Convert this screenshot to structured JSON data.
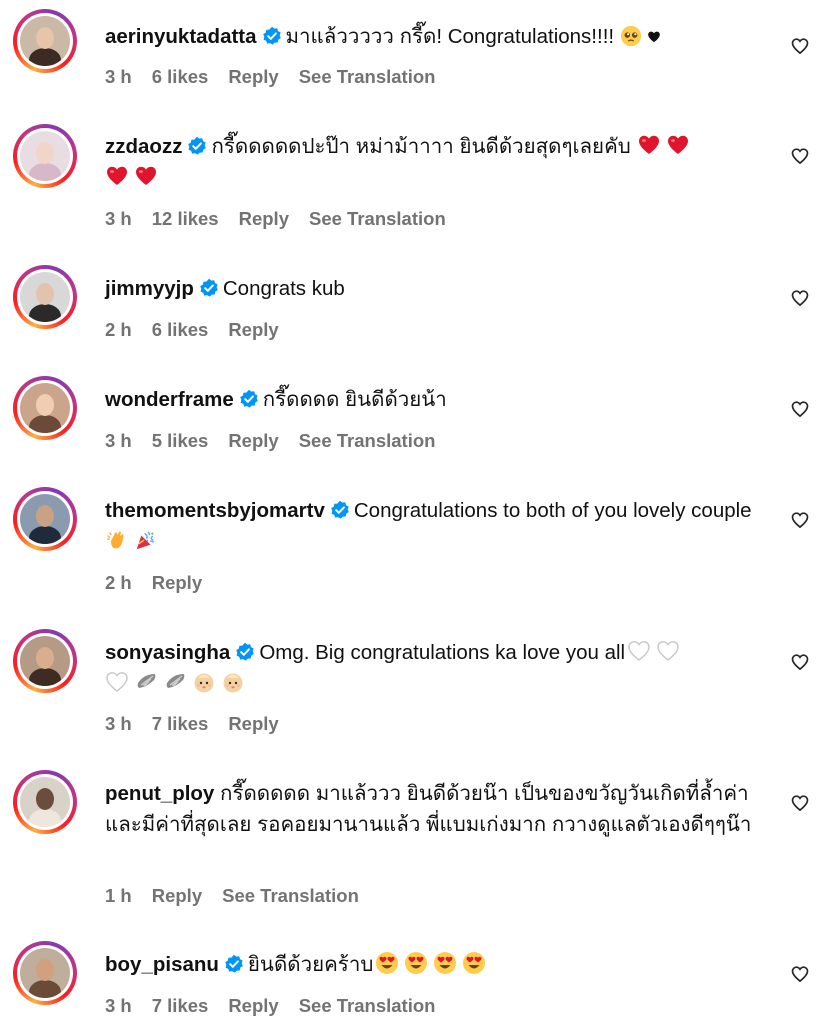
{
  "comments": [
    {
      "username": "aerinyuktadatta",
      "text": "มาแล้ววววว กรี๊ด! Congratulations!!!!",
      "time": "3 h",
      "likes": "6 likes",
      "reply": "Reply",
      "translate": "See Translation"
    },
    {
      "username": "zzdaozz",
      "text": "กรี๊ดดดดดปะป๊า หม่าม้าาาา ยินดีด้วยสุดๆเลยคับ",
      "time": "3 h",
      "likes": "12 likes",
      "reply": "Reply",
      "translate": "See Translation"
    },
    {
      "username": "jimmyyjp",
      "text": "Congrats kub",
      "time": "2 h",
      "likes": "6 likes",
      "reply": "Reply"
    },
    {
      "username": "wonderframe",
      "text": "กรี๊ดดดด ยินดีด้วยน้า",
      "time": "3 h",
      "likes": "5 likes",
      "reply": "Reply",
      "translate": "See Translation"
    },
    {
      "username": "themomentsbyjomartv",
      "text": "Congratulations to both of you lovely couple",
      "time": "2 h",
      "reply": "Reply"
    },
    {
      "username": "sonyasingha",
      "text": "Omg. Big congratulations ka love you all",
      "time": "3 h",
      "likes": "7 likes",
      "reply": "Reply"
    },
    {
      "username": "penut_ploy",
      "text": "กรี๊ดดดดด มาแล้ววว ยินดีด้วยน๊า เป็นของขวัญวันเกิดที่ล้ำค่า และมีค่าที่สุดเลย รอคอยมานานแล้ว พี่แบมเก่งมาก กวางดูแลตัวเองดีๆๆน๊า",
      "time": "1 h",
      "reply": "Reply",
      "translate": "See Translation"
    },
    {
      "username": "boy_pisanu",
      "text": "ยินดีด้วยคร้าบ",
      "time": "3 h",
      "likes": "7 likes",
      "reply": "Reply",
      "translate": "See Translation"
    }
  ],
  "icons": {
    "verified": "verified-badge-icon",
    "like": "heart-outline-icon",
    "pleading": "pleading-face-emoji",
    "black_heart": "black-heart-emoji",
    "red_heart": "red-heart-emoji",
    "clap": "clapping-hands-emoji",
    "party": "party-popper-emoji",
    "white_heart": "white-heart-emoji",
    "wings": "wing-emoji",
    "baby": "baby-emoji",
    "heart_eyes": "heart-eyes-emoji"
  },
  "colors": {
    "verified": "#0095f6",
    "meta": "#737373",
    "red_heart": "#e0142c"
  }
}
